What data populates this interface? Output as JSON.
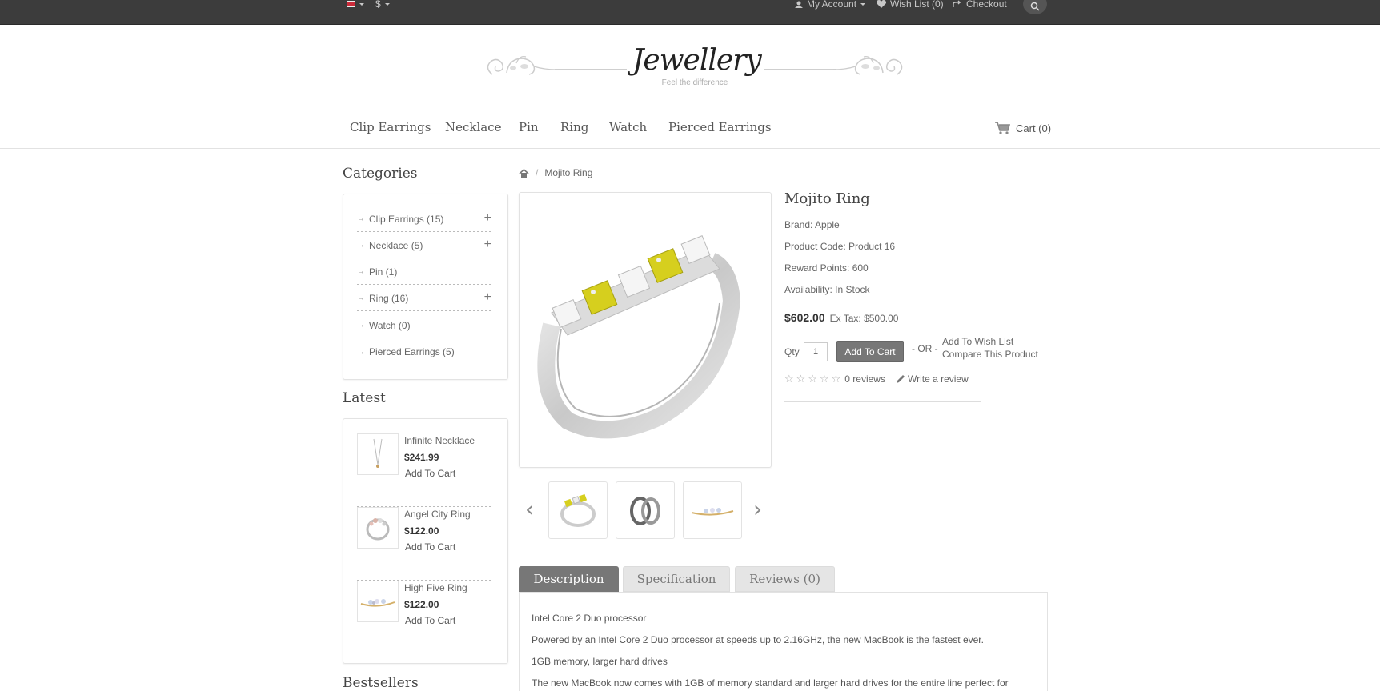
{
  "topbar": {
    "currency": "$",
    "my_account": "My Account",
    "wish_list": "Wish List (0)",
    "checkout": "Checkout"
  },
  "logo": {
    "title": "Jewellery",
    "tagline": "Feel the difference"
  },
  "nav": {
    "items": [
      "Clip Earrings",
      "Necklace",
      "Pin",
      "Ring",
      "Watch",
      "Pierced Earrings"
    ],
    "cart": "Cart (0)"
  },
  "sidebar": {
    "categories_title": "Categories",
    "categories": [
      {
        "label": "Clip Earrings (15)",
        "expandable": true
      },
      {
        "label": "Necklace (5)",
        "expandable": true
      },
      {
        "label": "Pin (1)",
        "expandable": false
      },
      {
        "label": "Ring (16)",
        "expandable": true
      },
      {
        "label": "Watch (0)",
        "expandable": false
      },
      {
        "label": "Pierced Earrings (5)",
        "expandable": false
      }
    ],
    "latest_title": "Latest",
    "latest": [
      {
        "name": "Infinite Necklace",
        "price": "$241.99",
        "action": "Add To Cart"
      },
      {
        "name": "Angel City Ring",
        "price": "$122.00",
        "action": "Add To Cart"
      },
      {
        "name": "High Five Ring",
        "price": "$122.00",
        "action": "Add To Cart"
      }
    ],
    "bestsellers_title": "Bestsellers"
  },
  "breadcrumb": {
    "current": "Mojito Ring"
  },
  "product": {
    "title": "Mojito Ring",
    "brand": "Brand: Apple",
    "code": "Product Code: Product 16",
    "reward": "Reward Points: 600",
    "availability": "Availability: In Stock",
    "price": "$602.00",
    "ex_tax": "Ex Tax: $500.00",
    "qty_label": "Qty",
    "qty_value": "1",
    "add_to_cart": "Add To Cart",
    "or_label": "- OR -",
    "wish_list": "Add To Wish List",
    "compare": "Compare This Product",
    "reviews": "0 reviews",
    "write_review": "Write a review",
    "rating": 0,
    "rating_max": 5
  },
  "tabs": {
    "items": [
      "Description",
      "Specification",
      "Reviews (0)"
    ],
    "active": 0
  },
  "description": [
    "Intel Core 2 Duo processor",
    "Powered by an Intel Core 2 Duo processor at speeds up to 2.16GHz, the new MacBook is the fastest ever.",
    "1GB memory, larger hard drives",
    "The new MacBook now comes with 1GB of memory standard and larger hard drives for the entire line perfect for"
  ],
  "colors": {
    "topbar": "#3c3c3c",
    "button": "#777777",
    "diamond_yellow": "#e6e03a"
  }
}
